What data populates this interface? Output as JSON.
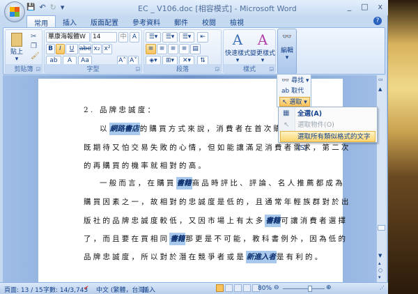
{
  "window": {
    "title": "EC _ V106.doc [相容模式] - Microsoft Word",
    "controls": [
      "_",
      "□",
      "x"
    ]
  },
  "qat": {
    "save": "💾",
    "undo": "↶",
    "redo": "↻",
    "more": "▾"
  },
  "tabs": [
    "常用",
    "插入",
    "版面配置",
    "參考資料",
    "郵件",
    "校閱",
    "檢視"
  ],
  "ribbon": {
    "clipboard": {
      "label": "剪貼簿",
      "paste": "貼上"
    },
    "font": {
      "label": "字型",
      "font_name": "華康海報體W",
      "font_size": "14",
      "bold": "B",
      "italic": "I",
      "underline": "U",
      "strike": "abe",
      "sub": "x₂",
      "sup": "x²",
      "grow": "A˄",
      "shrink": "A˅",
      "case": "Aa"
    },
    "paragraph": {
      "label": "段落"
    },
    "styles": {
      "label": "樣式",
      "quick": "快速樣式",
      "change": "變更樣式"
    },
    "editing": {
      "label": "編輯"
    }
  },
  "editing_popup": {
    "find": "尋找",
    "replace": "取代",
    "select": "選取"
  },
  "select_menu": {
    "items": [
      {
        "label": "全選(A)",
        "enabled": true
      },
      {
        "label": "選取物件(O)",
        "enabled": false
      },
      {
        "label": "選取所有類似格式的文字(S)",
        "enabled": true,
        "highlighted": true
      }
    ]
  },
  "document": {
    "heading": "2. 品牌忠誠度：",
    "p1": {
      "indent": "以",
      "hl": "網路書店",
      "rest": "的購買方式來說，消費者在首次購物時都是"
    },
    "p1_l2": "既期待又怕交易失敗的心情，但如能讓滿足消費者需求，第二次",
    "p1_l3": "的再購買的機率就相對的高。",
    "p2_l1": {
      "a": "一般而言，在購買",
      "hl": "書籍",
      "b": "商品時評比、評論、名人推薦都成為"
    },
    "p2_l2": "購買因素之一，故相對的忠誠度是低的，且通常年輕族群對於出",
    "p2_l3": {
      "a": "版社的品牌忠誠度較低，又因市場上有太多",
      "hl": "書籍",
      "b": "可讓消費者選擇"
    },
    "p2_l4": {
      "a": "了，而且要在買相同",
      "hl": "書籍",
      "b": "那更是不可能，教科書例外，因為低的"
    },
    "p2_l5": {
      "a": "品牌忠誠度，所以對於潛在競爭者或是",
      "hl": "新進入者",
      "b": "是有利的。"
    }
  },
  "status": {
    "page": "頁面: 13 / 15",
    "words": "字數: 14/3,743",
    "language": "中文 (繁體，台灣)",
    "mode": "插入",
    "zoom": "80%",
    "zoom_percent": 80
  }
}
